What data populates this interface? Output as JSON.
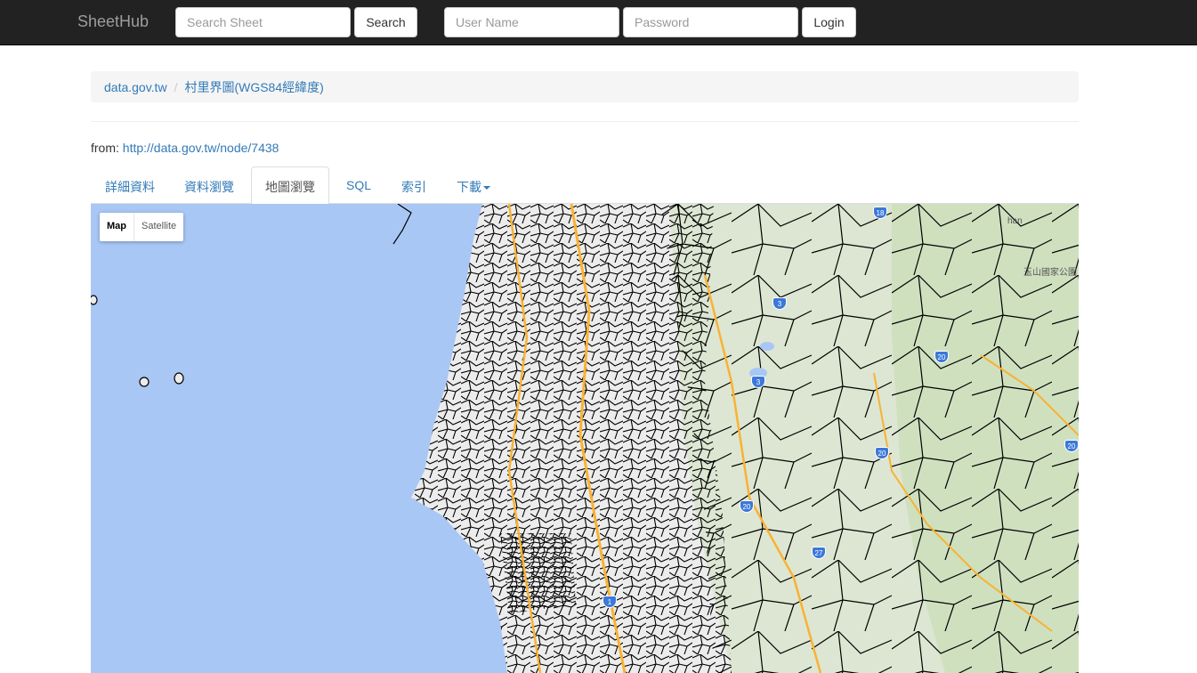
{
  "navbar": {
    "brand": "SheetHub",
    "search_placeholder": "Search Sheet",
    "search_button": "Search",
    "username_placeholder": "User Name",
    "password_placeholder": "Password",
    "login_button": "Login"
  },
  "breadcrumb": {
    "items": [
      "data.gov.tw",
      "村里界圖(WGS84經緯度)"
    ],
    "separator": "/"
  },
  "source": {
    "label": "from:",
    "url": "http://data.gov.tw/node/7438"
  },
  "tabs": [
    {
      "label": "詳細資料",
      "active": false
    },
    {
      "label": "資料瀏覽",
      "active": false
    },
    {
      "label": "地圖瀏覽",
      "active": true
    },
    {
      "label": "SQL",
      "active": false
    },
    {
      "label": "索引",
      "active": false
    },
    {
      "label": "下載",
      "active": false
    }
  ],
  "map": {
    "type_control": {
      "map": "Map",
      "satellite": "Satellite"
    },
    "road_shields": [
      "18",
      "3",
      "3",
      "20",
      "20",
      "20",
      "20",
      "27",
      "1"
    ],
    "place_labels": [
      "玉山國家公園",
      "han"
    ],
    "colors": {
      "ocean": "#a9c7f5",
      "land": "#ececec",
      "mountain": "#d3e3c4",
      "road": "#f9b234",
      "boundary": "#000000"
    }
  }
}
